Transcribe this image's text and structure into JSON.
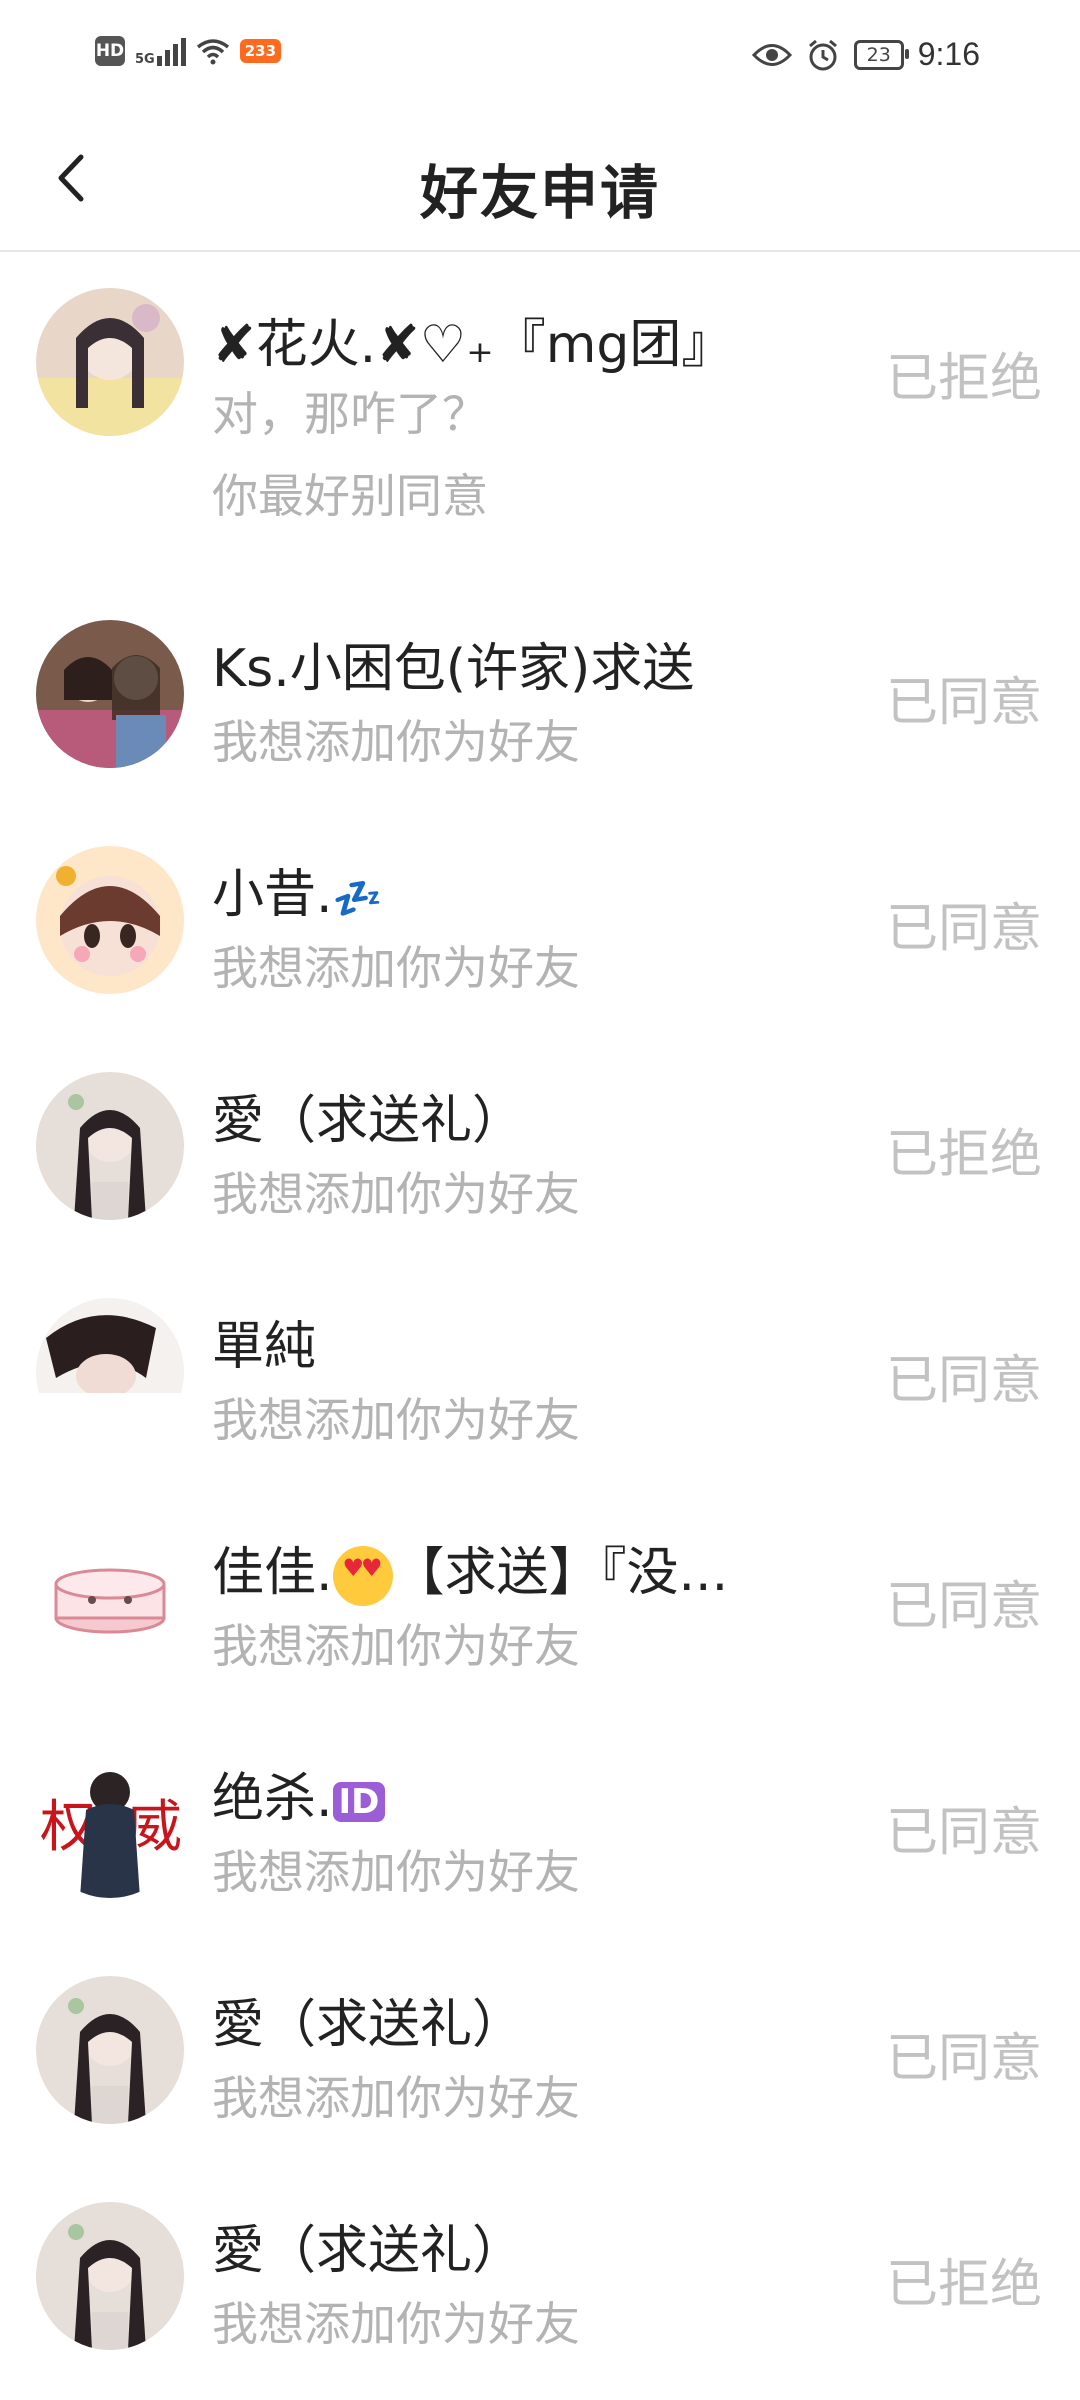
{
  "status_bar": {
    "hd": "HD",
    "network": "5G",
    "notif_count": "233",
    "battery": "23",
    "time": "9:16"
  },
  "header": {
    "title": "好友申请"
  },
  "requests": [
    {
      "name": "✘花火.✘♡₊『mg团』",
      "message": "对，那咋了？",
      "message2": "你最好别同意",
      "status": "已拒绝"
    },
    {
      "name": "Ks.小困包(许家)求送",
      "message": "我想添加你为好友",
      "status": "已同意"
    },
    {
      "name": "小昔.",
      "message": "我想添加你为好友",
      "status": "已同意"
    },
    {
      "name": "愛（求送礼）",
      "message": "我想添加你为好友",
      "status": "已拒绝"
    },
    {
      "name": "單純",
      "message": "我想添加你为好友",
      "status": "已同意"
    },
    {
      "name": "佳佳.",
      "name_suffix": "【求送】『没...",
      "message": "我想添加你为好友",
      "status": "已同意"
    },
    {
      "name": "绝杀.",
      "message": "我想添加你为好友",
      "status": "已同意"
    },
    {
      "name": "愛（求送礼）",
      "message": "我想添加你为好友",
      "status": "已同意"
    },
    {
      "name": "愛（求送礼）",
      "message": "我想添加你为好友",
      "status": "已拒绝"
    }
  ],
  "colors": {
    "accent_badge": "#ff6a1f",
    "status_text": "#c2c2c2",
    "secondary_text": "#b3b3b3"
  }
}
